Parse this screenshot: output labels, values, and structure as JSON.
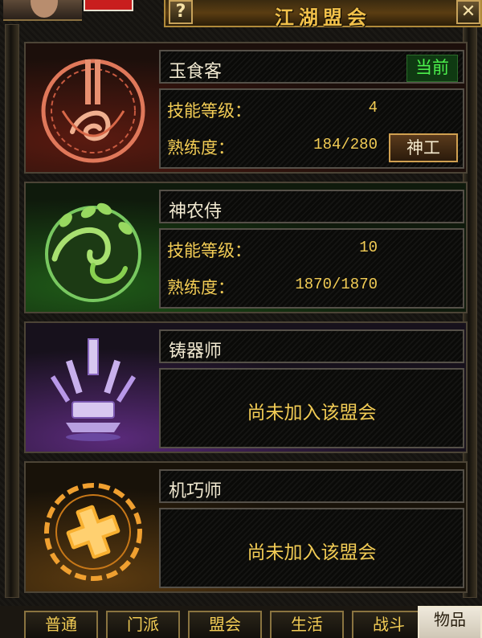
{
  "window": {
    "title": "江湖盟会",
    "help_label": "?",
    "close_label": "✕"
  },
  "guilds": [
    {
      "name": "玉食客",
      "theme": "red",
      "icon": "chef-emblem-icon",
      "status_badge": "当前",
      "skill_level_label": "技能等级：",
      "skill_level": "4",
      "proficiency_label": "熟练度：",
      "proficiency": "184/280",
      "action_label": "神工"
    },
    {
      "name": "神农侍",
      "theme": "green",
      "icon": "herbalist-emblem-icon",
      "skill_level_label": "技能等级：",
      "skill_level": "10",
      "proficiency_label": "熟练度：",
      "proficiency": "1870/1870"
    },
    {
      "name": "铸器师",
      "theme": "purple",
      "icon": "smith-emblem-icon",
      "not_joined_text": "尚未加入该盟会"
    },
    {
      "name": "机巧师",
      "theme": "orange",
      "icon": "artisan-emblem-icon",
      "not_joined_text": "尚未加入该盟会"
    }
  ],
  "tabs": [
    {
      "label": "普通"
    },
    {
      "label": "门派"
    },
    {
      "label": "盟会"
    },
    {
      "label": "生活"
    },
    {
      "label": "战斗"
    },
    {
      "label": "物品"
    }
  ],
  "active_tab": "物品",
  "colors": {
    "accent_gold": "#f2cc55",
    "current_green": "#4cf04c",
    "hp_red": "#c81e1e"
  }
}
